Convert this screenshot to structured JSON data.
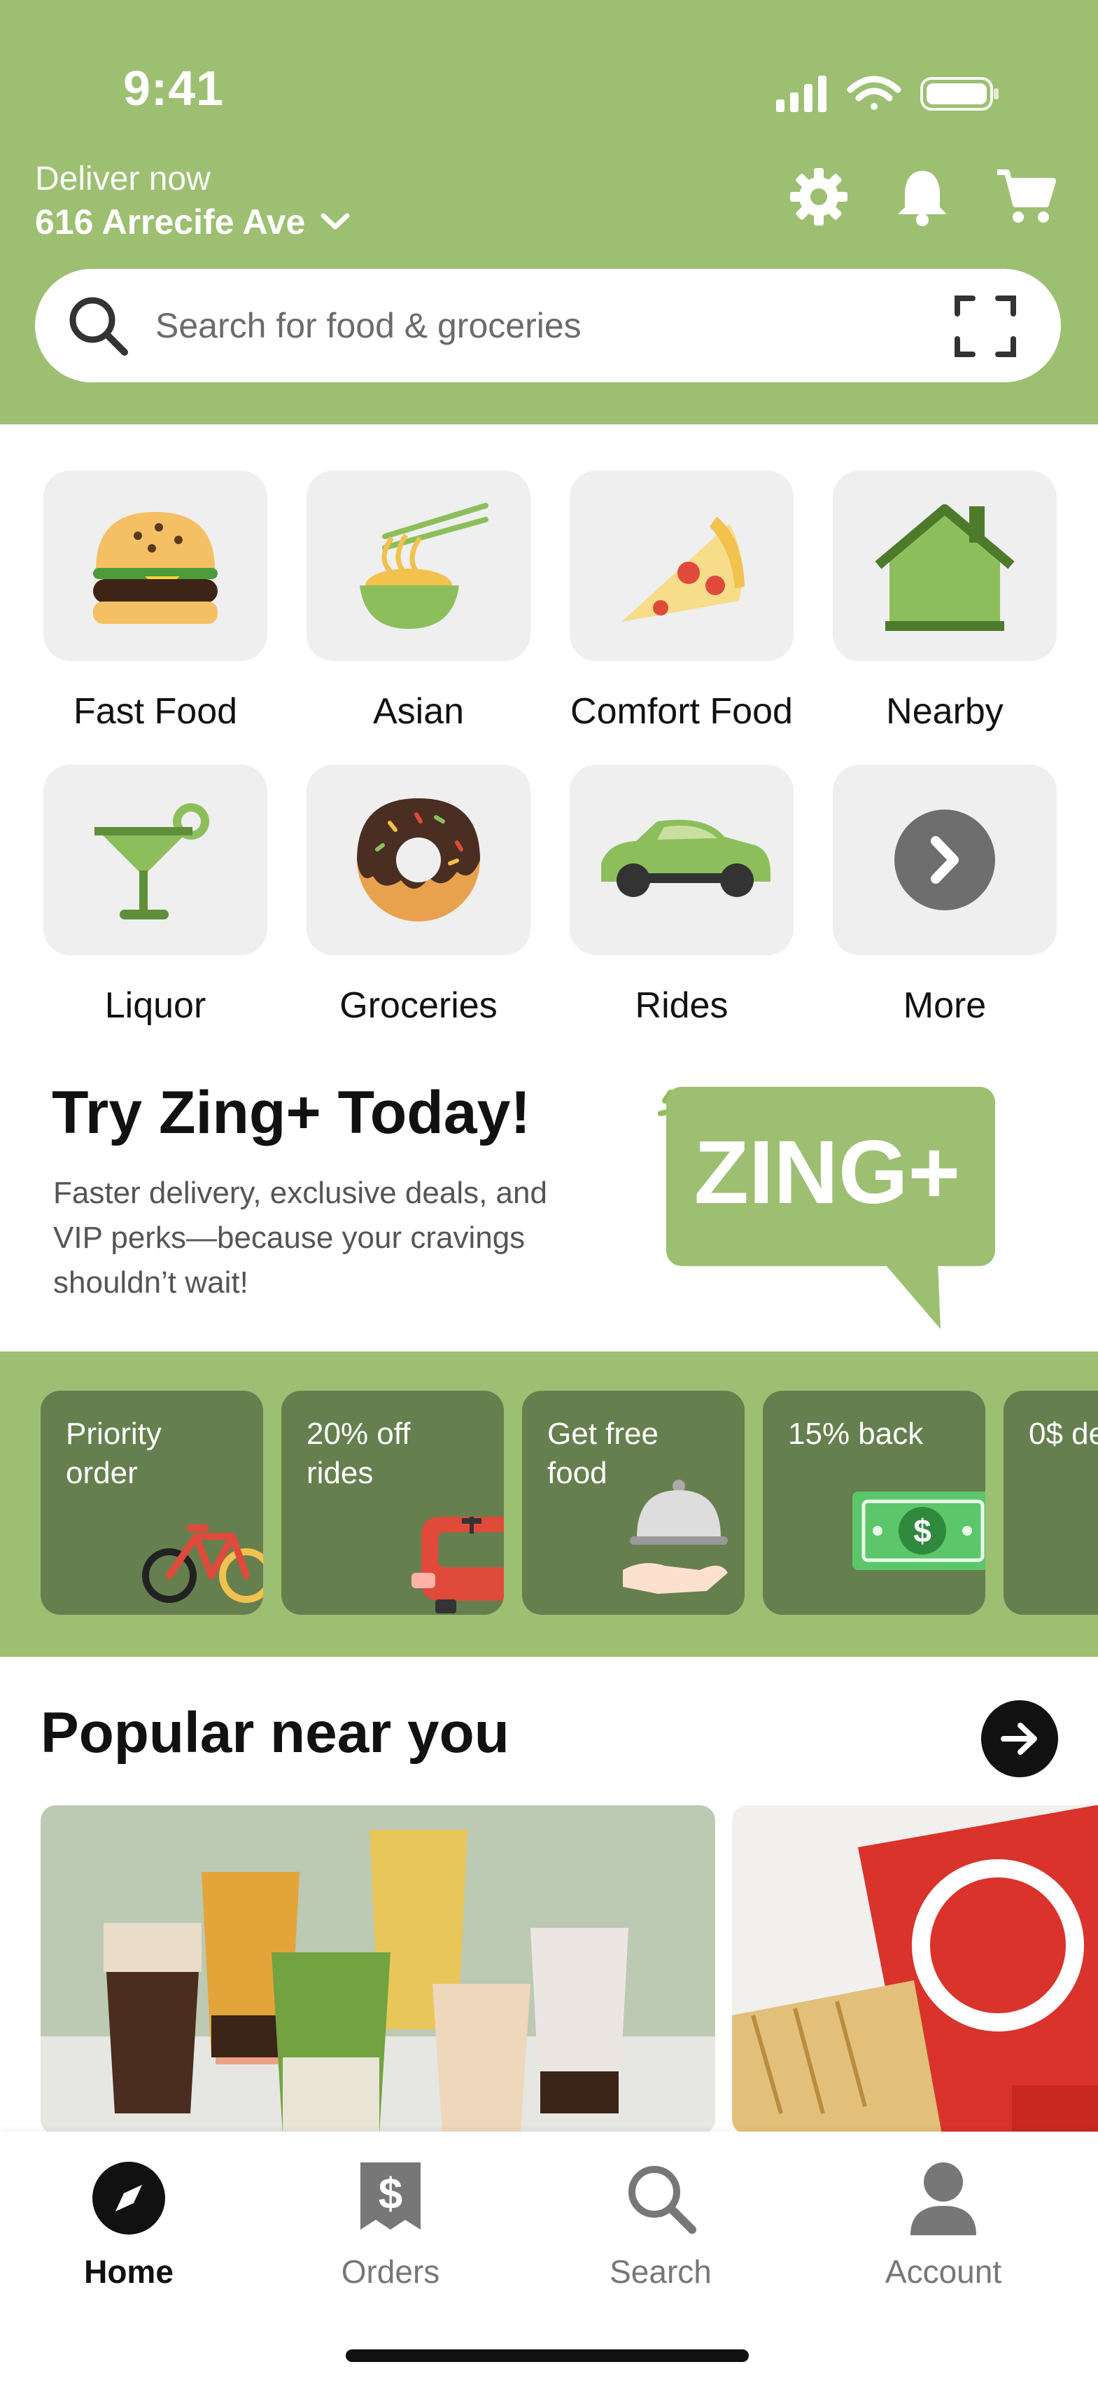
{
  "status_bar": {
    "time": "9:41",
    "icons": [
      "signal-icon",
      "wifi-icon",
      "battery-icon"
    ]
  },
  "header": {
    "deliver_label": "Deliver now",
    "address": "616 Arrecife Ave",
    "icons": [
      "gear-icon",
      "bell-icon",
      "cart-icon"
    ],
    "bg_color": "#9dbf72"
  },
  "search": {
    "placeholder": "Search for food & groceries"
  },
  "categories": [
    {
      "label": "Fast Food",
      "icon": "burger-icon"
    },
    {
      "label": "Asian",
      "icon": "noodles-icon"
    },
    {
      "label": "Comfort Food",
      "icon": "pizza-icon"
    },
    {
      "label": "Nearby",
      "icon": "house-icon"
    },
    {
      "label": "Liquor",
      "icon": "cocktail-icon"
    },
    {
      "label": "Groceries",
      "icon": "donut-icon"
    },
    {
      "label": "Rides",
      "icon": "car-icon"
    },
    {
      "label": "More",
      "icon": "chevron-right-icon"
    }
  ],
  "promo": {
    "title": "Try Zing+ Today!",
    "description": "Faster delivery, exclusive deals, and VIP perks—because your cravings shouldn’t wait!",
    "badge_text": "ZING+"
  },
  "perks": [
    {
      "label": "Priority order",
      "icon": "bicycle-icon"
    },
    {
      "label": "20% off rides",
      "icon": "car-icon"
    },
    {
      "label": "Get free food",
      "icon": "cloche-icon"
    },
    {
      "label": "15% back",
      "icon": "dollar-bill-icon"
    },
    {
      "label": "0$ de",
      "icon": ""
    }
  ],
  "popular": {
    "title": "Popular near you"
  },
  "bottom_nav": [
    {
      "label": "Home",
      "icon": "compass-icon",
      "active": true
    },
    {
      "label": "Orders",
      "icon": "receipt-icon",
      "active": false
    },
    {
      "label": "Search",
      "icon": "search-icon",
      "active": false
    },
    {
      "label": "Account",
      "icon": "person-icon",
      "active": false
    }
  ],
  "colors": {
    "accent": "#9dbf72",
    "perk_card": "#667f4f",
    "tile": "#efefef"
  }
}
